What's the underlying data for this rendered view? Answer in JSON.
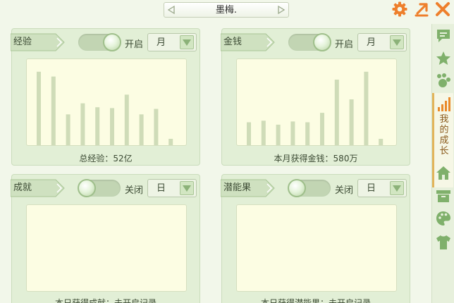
{
  "window": {
    "title": "墨梅."
  },
  "panels": {
    "experience": {
      "label": "经验",
      "toggle_label": "开启",
      "toggle_state": "on",
      "period": "月",
      "summary": "总经验：52亿",
      "bars": [
        0.93,
        0.87,
        0.39,
        0.53,
        0.48,
        0.47,
        0.64,
        0.39,
        0.46,
        0.08
      ]
    },
    "money": {
      "label": "金钱",
      "toggle_label": "开启",
      "toggle_state": "on",
      "period": "月",
      "summary": "本月获得金钱：580万",
      "bars": [
        0.29,
        0.31,
        0.26,
        0.3,
        0.29,
        0.41,
        0.83,
        0.58,
        0.93,
        0.08
      ]
    },
    "achievement": {
      "label": "成就",
      "toggle_label": "关闭",
      "toggle_state": "off",
      "period": "日",
      "summary": "本日获得成就：未开启记录"
    },
    "potential": {
      "label": "潜能果",
      "toggle_label": "关闭",
      "toggle_state": "off",
      "period": "日",
      "summary": "本日获得潜能果：未开启记录"
    }
  },
  "sidebar": {
    "items": [
      {
        "icon": "chat-icon"
      },
      {
        "icon": "star-icon"
      },
      {
        "icon": "paw-icon"
      },
      {
        "icon": "growth-bars-icon",
        "label": "我的成长",
        "active": true
      },
      {
        "icon": "house-icon"
      },
      {
        "icon": "box-icon"
      },
      {
        "icon": "palette-icon"
      },
      {
        "icon": "shirt-icon"
      }
    ]
  },
  "colors": {
    "bar": "#cfdcb8",
    "accent_orange": "#ee7f2c",
    "panel_bg": "#e2efd6",
    "chart_bg": "#fcfde3"
  }
}
